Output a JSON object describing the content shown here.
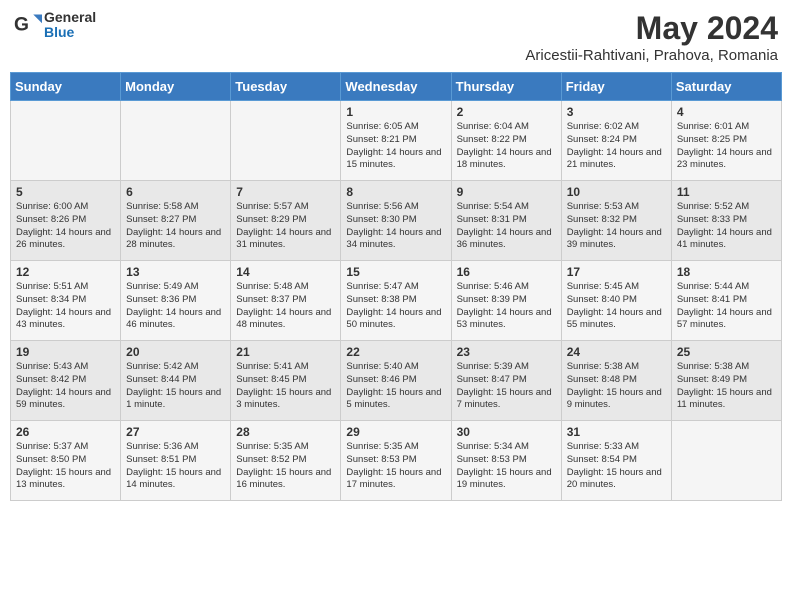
{
  "header": {
    "logo_line1": "General",
    "logo_line2": "Blue",
    "month_year": "May 2024",
    "location": "Aricestii-Rahtivani, Prahova, Romania"
  },
  "days_of_week": [
    "Sunday",
    "Monday",
    "Tuesday",
    "Wednesday",
    "Thursday",
    "Friday",
    "Saturday"
  ],
  "weeks": [
    [
      {
        "day": "",
        "info": ""
      },
      {
        "day": "",
        "info": ""
      },
      {
        "day": "",
        "info": ""
      },
      {
        "day": "1",
        "info": "Sunrise: 6:05 AM\nSunset: 8:21 PM\nDaylight: 14 hours and 15 minutes."
      },
      {
        "day": "2",
        "info": "Sunrise: 6:04 AM\nSunset: 8:22 PM\nDaylight: 14 hours and 18 minutes."
      },
      {
        "day": "3",
        "info": "Sunrise: 6:02 AM\nSunset: 8:24 PM\nDaylight: 14 hours and 21 minutes."
      },
      {
        "day": "4",
        "info": "Sunrise: 6:01 AM\nSunset: 8:25 PM\nDaylight: 14 hours and 23 minutes."
      }
    ],
    [
      {
        "day": "5",
        "info": "Sunrise: 6:00 AM\nSunset: 8:26 PM\nDaylight: 14 hours and 26 minutes."
      },
      {
        "day": "6",
        "info": "Sunrise: 5:58 AM\nSunset: 8:27 PM\nDaylight: 14 hours and 28 minutes."
      },
      {
        "day": "7",
        "info": "Sunrise: 5:57 AM\nSunset: 8:29 PM\nDaylight: 14 hours and 31 minutes."
      },
      {
        "day": "8",
        "info": "Sunrise: 5:56 AM\nSunset: 8:30 PM\nDaylight: 14 hours and 34 minutes."
      },
      {
        "day": "9",
        "info": "Sunrise: 5:54 AM\nSunset: 8:31 PM\nDaylight: 14 hours and 36 minutes."
      },
      {
        "day": "10",
        "info": "Sunrise: 5:53 AM\nSunset: 8:32 PM\nDaylight: 14 hours and 39 minutes."
      },
      {
        "day": "11",
        "info": "Sunrise: 5:52 AM\nSunset: 8:33 PM\nDaylight: 14 hours and 41 minutes."
      }
    ],
    [
      {
        "day": "12",
        "info": "Sunrise: 5:51 AM\nSunset: 8:34 PM\nDaylight: 14 hours and 43 minutes."
      },
      {
        "day": "13",
        "info": "Sunrise: 5:49 AM\nSunset: 8:36 PM\nDaylight: 14 hours and 46 minutes."
      },
      {
        "day": "14",
        "info": "Sunrise: 5:48 AM\nSunset: 8:37 PM\nDaylight: 14 hours and 48 minutes."
      },
      {
        "day": "15",
        "info": "Sunrise: 5:47 AM\nSunset: 8:38 PM\nDaylight: 14 hours and 50 minutes."
      },
      {
        "day": "16",
        "info": "Sunrise: 5:46 AM\nSunset: 8:39 PM\nDaylight: 14 hours and 53 minutes."
      },
      {
        "day": "17",
        "info": "Sunrise: 5:45 AM\nSunset: 8:40 PM\nDaylight: 14 hours and 55 minutes."
      },
      {
        "day": "18",
        "info": "Sunrise: 5:44 AM\nSunset: 8:41 PM\nDaylight: 14 hours and 57 minutes."
      }
    ],
    [
      {
        "day": "19",
        "info": "Sunrise: 5:43 AM\nSunset: 8:42 PM\nDaylight: 14 hours and 59 minutes."
      },
      {
        "day": "20",
        "info": "Sunrise: 5:42 AM\nSunset: 8:44 PM\nDaylight: 15 hours and 1 minute."
      },
      {
        "day": "21",
        "info": "Sunrise: 5:41 AM\nSunset: 8:45 PM\nDaylight: 15 hours and 3 minutes."
      },
      {
        "day": "22",
        "info": "Sunrise: 5:40 AM\nSunset: 8:46 PM\nDaylight: 15 hours and 5 minutes."
      },
      {
        "day": "23",
        "info": "Sunrise: 5:39 AM\nSunset: 8:47 PM\nDaylight: 15 hours and 7 minutes."
      },
      {
        "day": "24",
        "info": "Sunrise: 5:38 AM\nSunset: 8:48 PM\nDaylight: 15 hours and 9 minutes."
      },
      {
        "day": "25",
        "info": "Sunrise: 5:38 AM\nSunset: 8:49 PM\nDaylight: 15 hours and 11 minutes."
      }
    ],
    [
      {
        "day": "26",
        "info": "Sunrise: 5:37 AM\nSunset: 8:50 PM\nDaylight: 15 hours and 13 minutes."
      },
      {
        "day": "27",
        "info": "Sunrise: 5:36 AM\nSunset: 8:51 PM\nDaylight: 15 hours and 14 minutes."
      },
      {
        "day": "28",
        "info": "Sunrise: 5:35 AM\nSunset: 8:52 PM\nDaylight: 15 hours and 16 minutes."
      },
      {
        "day": "29",
        "info": "Sunrise: 5:35 AM\nSunset: 8:53 PM\nDaylight: 15 hours and 17 minutes."
      },
      {
        "day": "30",
        "info": "Sunrise: 5:34 AM\nSunset: 8:53 PM\nDaylight: 15 hours and 19 minutes."
      },
      {
        "day": "31",
        "info": "Sunrise: 5:33 AM\nSunset: 8:54 PM\nDaylight: 15 hours and 20 minutes."
      },
      {
        "day": "",
        "info": ""
      }
    ]
  ]
}
